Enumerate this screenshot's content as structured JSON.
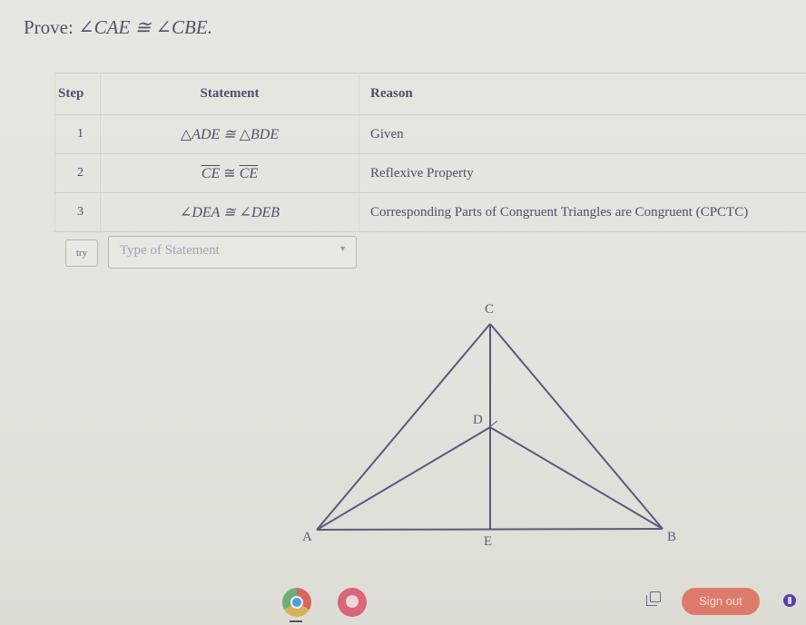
{
  "prove": {
    "label": "Prove:",
    "statement": "∠CAE ≅ ∠CBE."
  },
  "table": {
    "headers": {
      "step": "Step",
      "statement": "Statement",
      "reason": "Reason"
    },
    "rows": [
      {
        "step": "1",
        "statement": "△ADE ≅ △BDE",
        "reason": "Given"
      },
      {
        "step": "2",
        "statement_left": "CE",
        "statement_op": " ≅ ",
        "statement_right": "CE",
        "reason": "Reflexive Property"
      },
      {
        "step": "3",
        "statement": "∠DEA ≅ ∠DEB",
        "reason": "Corresponding Parts of Congruent Triangles are Congruent (CPCTC)"
      }
    ]
  },
  "input_row": {
    "try_label": "try",
    "statement_placeholder": "Type of Statement",
    "caret_icon": "chevron-down-icon"
  },
  "diagram": {
    "points": {
      "A": "A",
      "B": "B",
      "C": "C",
      "D": "D",
      "E": "E"
    },
    "segments": [
      "AC",
      "BC",
      "AB",
      "CE",
      "AD",
      "BD"
    ]
  },
  "shelf": {
    "apps": [
      "chrome-icon",
      "app-icon"
    ],
    "screenshot_icon": "screen-capture-icon",
    "sign_out_label": "Sign out",
    "status_icon": "battery-icon",
    "colors": {
      "sign_out": "#dc7b6b",
      "status": "#5b3fa8"
    }
  }
}
